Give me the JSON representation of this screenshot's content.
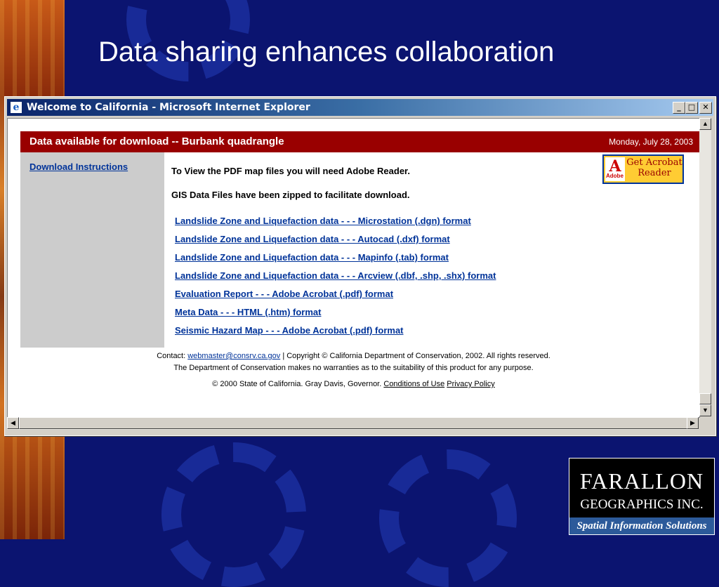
{
  "slide": {
    "title": "Data sharing enhances collaboration"
  },
  "browser": {
    "window_title": "Welcome to California - Microsoft Internet Explorer",
    "controls": {
      "minimize": "_",
      "maximize": "□",
      "close": "✕"
    }
  },
  "page": {
    "header_title": "Data available for download -- Burbank quadrangle",
    "header_date": "Monday, July 28, 2003",
    "sidebar_link": "Download Instructions",
    "intro_1": "To View the PDF map files you will need Adobe Reader.",
    "intro_2": "GIS Data Files have been zipped to facilitate download.",
    "acrobat_badge": {
      "line1": "Get Acrobat",
      "line2": "Reader",
      "brand": "Adobe"
    },
    "links": [
      "Landslide Zone and Liquefaction data - - - Microstation (.dgn) format",
      "Landslide Zone and Liquefaction data - - - Autocad (.dxf) format",
      "Landslide Zone and Liquefaction data - - - Mapinfo (.tab) format",
      "Landslide Zone and Liquefaction data - - - Arcview (.dbf, .shp, .shx) format",
      "Evaluation Report - - - Adobe Acrobat (.pdf) format",
      "Meta Data - - - HTML (.htm) format",
      "Seismic Hazard Map - - - Adobe Acrobat (.pdf) format"
    ],
    "footer": {
      "contact_label": "Contact:",
      "contact_email": "webmaster@consrv.ca.gov",
      "copyright": "| Copyright © California Department of Conservation, 2002. All rights reserved.",
      "disclaimer": "The Department of Conservation makes no warranties as to the suitability of this product for any purpose.",
      "state": "© 2000 State of California. Gray Davis, Governor.",
      "conditions": "Conditions of Use",
      "privacy": "Privacy Policy"
    }
  },
  "logo": {
    "line1": "FARALLON",
    "line2": "GEOGRAPHICS INC.",
    "tagline": "Spatial Information Solutions"
  },
  "colors": {
    "slide_bg": "#0b1470",
    "header_bar": "#990000",
    "sidebar": "#cccccc",
    "link": "#003399"
  }
}
